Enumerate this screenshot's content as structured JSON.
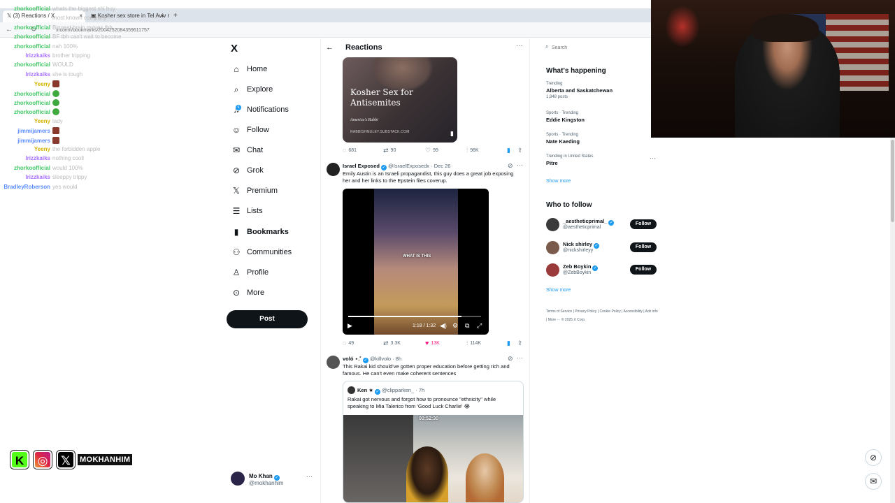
{
  "browser": {
    "tabs": [
      {
        "label": "(3) Reactions / X",
        "active": true
      },
      {
        "label": "Kosher sex store in Tel Aviv raises",
        "active": false
      }
    ],
    "url": "x.com/i/bookmarks/2004252084359611757",
    "add_tab": "+"
  },
  "chat": [
    {
      "user": "zhorkoofficial",
      "msg": "whats the biggest shi buy",
      "color": "#44c767"
    },
    {
      "user": "",
      "msg": "most known company",
      "color": "#bbb"
    },
    {
      "user": "zhorkoofficial",
      "msg": "Biggest brain moves tbh",
      "color": "#44c767"
    },
    {
      "user": "zhorkoofficial",
      "msg": "BF tbh can't wait to become",
      "color": "#44c767"
    },
    {
      "user": "zhorkoofficial",
      "msg": "nah 100%",
      "color": "#44c767"
    },
    {
      "user": "lrizzkaiks",
      "msg": "brother tripping",
      "color": "#a970ff"
    },
    {
      "user": "zhorkoofficial",
      "msg": "WOULD",
      "color": "#44c767"
    },
    {
      "user": "lrizzkaiks",
      "msg": "she is tough",
      "color": "#a970ff"
    },
    {
      "user": "Yeeny",
      "msg": "",
      "color": "#d6b300"
    },
    {
      "user": "zhorkoofficial",
      "msg": "",
      "color": "#44c767"
    },
    {
      "user": "zhorkoofficial",
      "msg": "",
      "color": "#44c767"
    },
    {
      "user": "zhorkoofficial",
      "msg": "",
      "color": "#44c767"
    },
    {
      "user": "Yeeny",
      "msg": "lady",
      "color": "#d6b300"
    },
    {
      "user": "jimmijamers",
      "msg": "",
      "color": "#5b8cff"
    },
    {
      "user": "jimmijamers",
      "msg": "",
      "color": "#5b8cff"
    },
    {
      "user": "Yeeny",
      "msg": "the forbidden apple",
      "color": "#d6b300"
    },
    {
      "user": "lrizzkaiks",
      "msg": "nothing cooll",
      "color": "#a970ff"
    },
    {
      "user": "zhorkoofficial",
      "msg": "would 100%",
      "color": "#44c767"
    },
    {
      "user": "lrizzkaiks",
      "msg": "sleeppy trippy",
      "color": "#a970ff"
    },
    {
      "user": "BradleyRoberson",
      "msg": "yes would",
      "color": "#5b8cff"
    }
  ],
  "streamer_handle": "MOKHANHIM",
  "nav": {
    "logo": "X",
    "items": [
      {
        "label": "Home",
        "icon": "home-icon",
        "glyph": "⌂"
      },
      {
        "label": "Explore",
        "icon": "search-icon",
        "glyph": "⌕"
      },
      {
        "label": "Notifications",
        "icon": "bell-icon",
        "glyph": "♫"
      },
      {
        "label": "Follow",
        "icon": "person-plus-icon",
        "glyph": "☺"
      },
      {
        "label": "Chat",
        "icon": "mail-icon",
        "glyph": "✉"
      },
      {
        "label": "Grok",
        "icon": "grok-icon",
        "glyph": "⊘"
      },
      {
        "label": "Premium",
        "icon": "x-logo-icon",
        "glyph": "𝕏"
      },
      {
        "label": "Lists",
        "icon": "list-icon",
        "glyph": "☰"
      },
      {
        "label": "Bookmarks",
        "icon": "bookmark-icon",
        "glyph": "▮"
      },
      {
        "label": "Communities",
        "icon": "communities-icon",
        "glyph": "⚇"
      },
      {
        "label": "Profile",
        "icon": "profile-icon",
        "glyph": "♙"
      },
      {
        "label": "More",
        "icon": "more-circle-icon",
        "glyph": "⊙"
      }
    ],
    "notification_count": "6",
    "post_label": "Post",
    "account": {
      "name": "Mo Khan",
      "handle": "@mokhanhim",
      "more": "···"
    }
  },
  "header": {
    "title": "Reactions",
    "back": "←",
    "more": "···"
  },
  "card": {
    "headline": "Kosher Sex for Antisemites",
    "sub": "America's Rabbi",
    "domain": "RABBISHMULEY.SUBSTACK.COM"
  },
  "actions1": {
    "replies": "681",
    "reposts": "90",
    "likes": "99",
    "views": "98K"
  },
  "tweet1": {
    "name": "Israel Exposed",
    "handle": "@IsraelExposedx",
    "date": "· Dec 26",
    "text": "Emily Austin is an Israeli propagandist, this guy does a great job exposing her and her links to the Epstein files coverup.",
    "video_caption": "WHAT IS THIS",
    "video_time": "1:18 / 1:32",
    "progress": 0.85
  },
  "actions2": {
    "replies": "49",
    "reposts": "3.3K",
    "likes": "13K",
    "views": "114K"
  },
  "tweet2": {
    "name": "voló ⋆.˚",
    "handle": "@killvolo",
    "date": "· 8h",
    "text": "This Rakai kid should've gotten proper education before getting rich and famous. He can't even make coherent sentences",
    "quote_name": "Ken ★",
    "quote_handle": "@clipparken_",
    "quote_date": "· 7h",
    "quote_text": "Rakai got nervous and forgot how to pronounce \"ethnicity\" while speaking to Mia Talerico from 'Good Luck Charlie' 😭",
    "quote_timestamp": "00:52:30"
  },
  "search": {
    "placeholder": "Search"
  },
  "whats_happening": {
    "title": "What's happening",
    "trends": [
      {
        "context": "Trending",
        "name": "Alberta and Saskatchewan",
        "posts": "1,848 posts"
      },
      {
        "context": "Sports · Trending",
        "name": "Eddie Kingston",
        "posts": ""
      },
      {
        "context": "Sports · Trending",
        "name": "Nate Kaeding",
        "posts": ""
      },
      {
        "context": "Trending in United States",
        "name": "Pitre",
        "posts": ""
      }
    ],
    "show_more": "Show more",
    "trend_more": "···"
  },
  "who_to_follow": {
    "title": "Who to follow",
    "accounts": [
      {
        "name": "_aestheticprimal_",
        "handle": "@aestheticprimal",
        "avatar_color": "#3b3b3b"
      },
      {
        "name": "Nick shirley",
        "handle": "@nickshirleyy",
        "avatar_color": "#7a5a4a"
      },
      {
        "name": "Zeb Boykin",
        "handle": "@ZebBoykin",
        "avatar_color": "#9a3a3a"
      }
    ],
    "follow_label": "Follow",
    "show_more": "Show more"
  },
  "footer": {
    "links": "Terms of Service | Privacy Policy | Cookie Policy | Accessibility | Ads info | More ··· © 2025 X Corp."
  },
  "colors": {
    "accent": "#1d9bf0",
    "like": "#f91880",
    "text": "#0f1419",
    "muted": "#536471"
  }
}
